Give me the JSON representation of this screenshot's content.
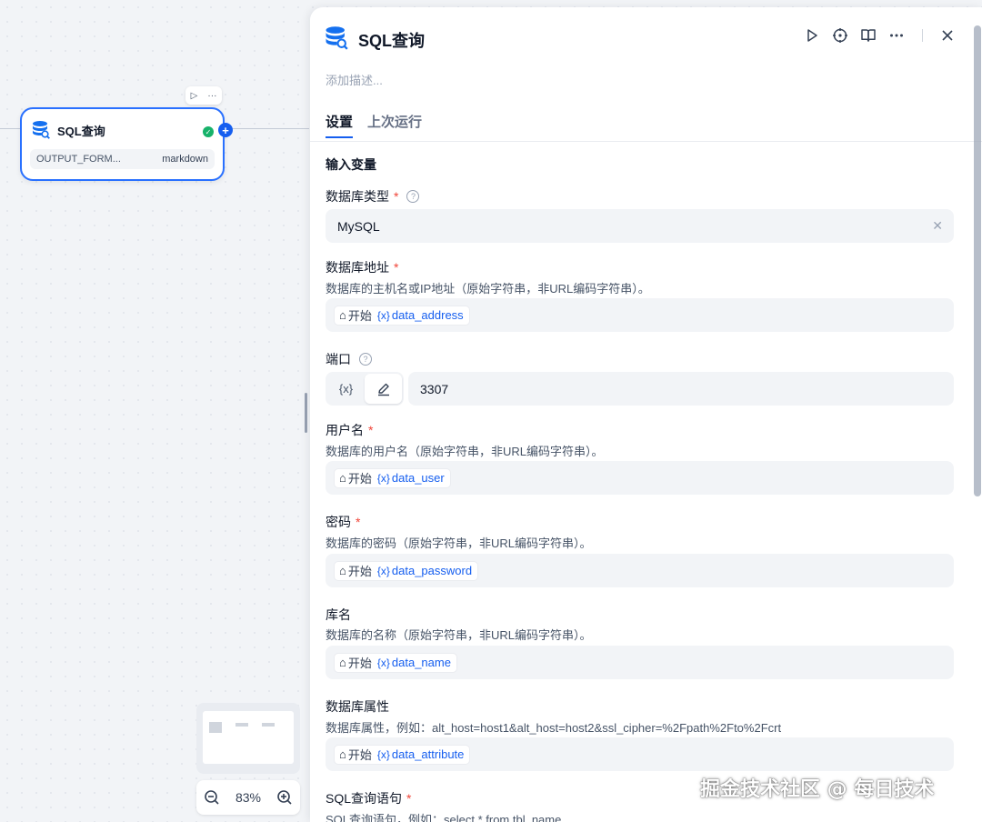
{
  "canvas": {
    "node": {
      "title": "SQL查询",
      "var_name": "OUTPUT_FORM...",
      "var_value": "markdown",
      "toolbar_more": "···"
    },
    "zoom_level": "83%"
  },
  "panel": {
    "title": "SQL查询",
    "description_placeholder": "添加描述...",
    "tabs": [
      "设置",
      "上次运行"
    ],
    "section_title": "输入变量",
    "db_type": {
      "label": "数据库类型",
      "required": "*",
      "help": "?",
      "value": "MySQL",
      "clear": "✕"
    },
    "db_address": {
      "label": "数据库地址",
      "required": "*",
      "desc": "数据库的主机名或IP地址（原始字符串，非URL编码字符串）。",
      "node": "开始",
      "var_icon": "{x}",
      "var": "data_address"
    },
    "port": {
      "label": "端口",
      "help": "?",
      "mode_var": "{x}",
      "value": "3307"
    },
    "username": {
      "label": "用户名",
      "required": "*",
      "desc": "数据库的用户名（原始字符串，非URL编码字符串）。",
      "node": "开始",
      "var_icon": "{x}",
      "var": "data_user"
    },
    "password": {
      "label": "密码",
      "required": "*",
      "desc": "数据库的密码（原始字符串，非URL编码字符串）。",
      "node": "开始",
      "var_icon": "{x}",
      "var": "data_password"
    },
    "db_name": {
      "label": "库名",
      "desc": "数据库的名称（原始字符串，非URL编码字符串）。",
      "node": "开始",
      "var_icon": "{x}",
      "var": "data_name"
    },
    "db_props": {
      "label": "数据库属性",
      "desc": "数据库属性，例如：alt_host=host1&alt_host=host2&ssl_cipher=%2Fpath%2Fto%2Fcrt",
      "node": "开始",
      "var_icon": "{x}",
      "var": "data_attribute"
    },
    "sql": {
      "label": "SQL查询语句",
      "required": "*",
      "desc": "SQL查询语句，例如：select * from tbl_name"
    }
  },
  "watermark": "掘金技术社区 @ 每日技术",
  "colors": {
    "accent": "#155eef",
    "success": "#17b26a",
    "required": "#f04438"
  }
}
